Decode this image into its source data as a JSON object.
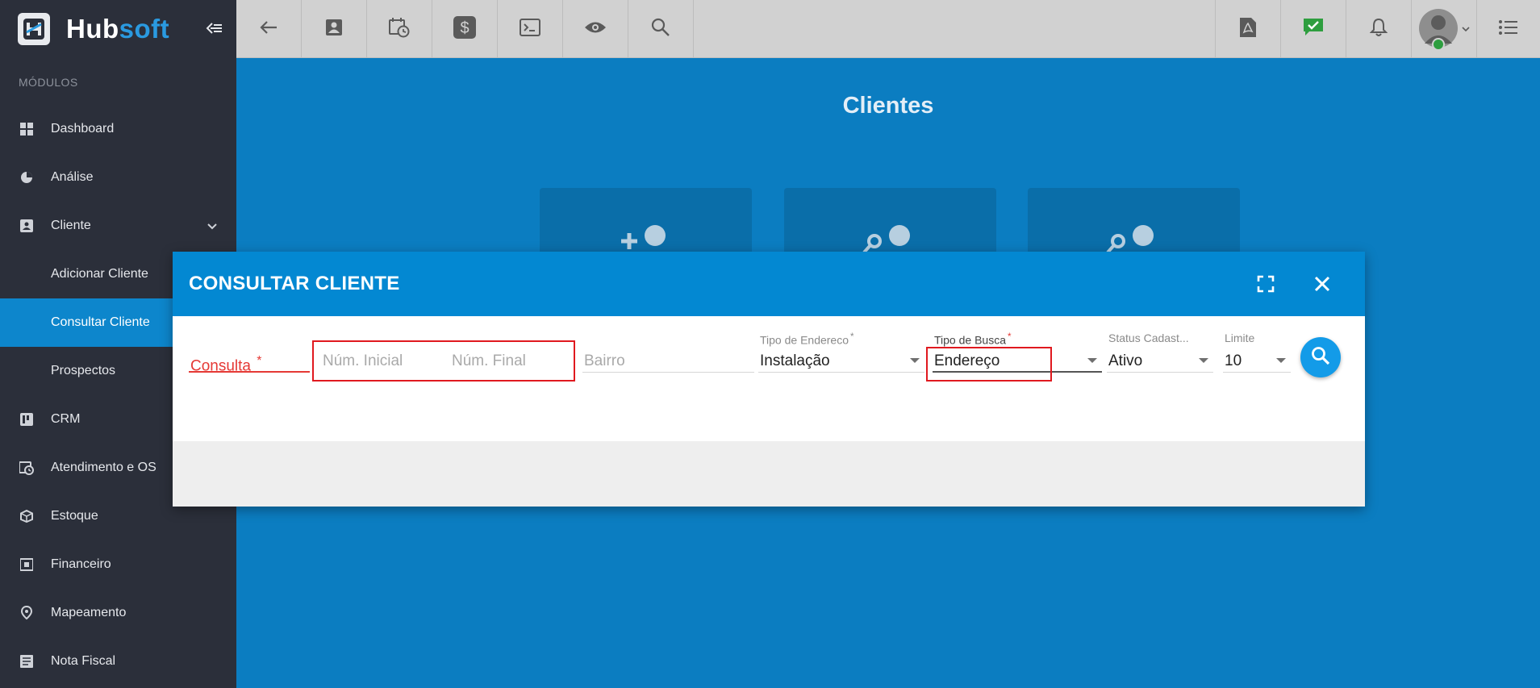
{
  "brand": {
    "name_part1": "Hub",
    "name_part2": "soft"
  },
  "sidebar": {
    "section_label": "MÓDULOS",
    "items": [
      {
        "label": "Dashboard",
        "icon": "grid-icon"
      },
      {
        "label": "Análise",
        "icon": "pie-chart-icon"
      },
      {
        "label": "Cliente",
        "icon": "contact-card-icon",
        "expanded": true
      },
      {
        "label": "Adicionar Cliente",
        "sub": true
      },
      {
        "label": "Consultar Cliente",
        "sub": true,
        "active": true
      },
      {
        "label": "Prospectos",
        "sub": true
      },
      {
        "label": "CRM",
        "icon": "kanban-icon"
      },
      {
        "label": "Atendimento e OS",
        "icon": "calendar-clock-icon"
      },
      {
        "label": "Estoque",
        "icon": "box-icon"
      },
      {
        "label": "Financeiro",
        "icon": "money-icon"
      },
      {
        "label": "Mapeamento",
        "icon": "map-pin-icon"
      },
      {
        "label": "Nota Fiscal",
        "icon": "document-icon"
      }
    ]
  },
  "topbar": {
    "left_icons": [
      "back-arrow-icon",
      "contact-card-icon",
      "calendar-clock-icon",
      "dollar-icon",
      "terminal-icon",
      "eye-icon",
      "search-icon"
    ],
    "right_icons": [
      "pdf-icon",
      "chat-check-icon",
      "bell-icon",
      "avatar",
      "list-menu-icon"
    ]
  },
  "main": {
    "title": "Clientes"
  },
  "modal": {
    "title": "CONSULTAR CLIENTE",
    "fields": {
      "consulta": {
        "placeholder": "Consulta",
        "required": "*"
      },
      "num_inicial": {
        "placeholder": "Núm. Inicial"
      },
      "num_final": {
        "placeholder": "Núm. Final"
      },
      "bairro": {
        "placeholder": "Bairro"
      },
      "tipo_endereco": {
        "label": "Tipo de Endereco",
        "required": "*",
        "value": "Instalação"
      },
      "tipo_busca": {
        "label": "Tipo de Busca",
        "required": "*",
        "value": "Endereço"
      },
      "status_cadastro": {
        "label": "Status Cadast...",
        "value": "Ativo"
      },
      "limite": {
        "label": "Limite",
        "value": "10"
      }
    }
  },
  "colors": {
    "sidebar_bg": "#2b2f3a",
    "accent": "#0d86cc",
    "main_bg": "#0b7dc1",
    "modal_header": "#0388d2",
    "error": "#e53935",
    "highlight": "#e0191f"
  }
}
